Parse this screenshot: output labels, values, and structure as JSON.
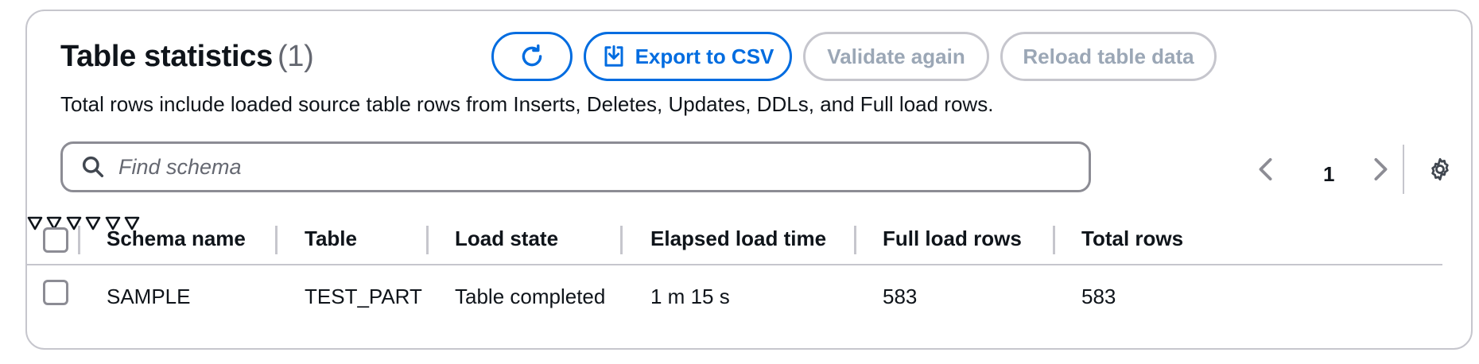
{
  "header": {
    "title": "Table statistics",
    "count": "(1)",
    "description": "Total rows include loaded source table rows from Inserts, Deletes, Updates, DDLs, and Full load rows."
  },
  "toolbar": {
    "refresh_icon": "refresh-icon",
    "export_label": "Export to CSV",
    "export_icon": "download-icon",
    "validate_label": "Validate again",
    "reload_label": "Reload table data"
  },
  "search": {
    "placeholder": "Find schema",
    "value": ""
  },
  "pagination": {
    "current_page": "1"
  },
  "table": {
    "columns": [
      "Schema name",
      "Table",
      "Load state",
      "Elapsed load time",
      "Full load rows",
      "Total rows"
    ],
    "rows": [
      [
        "SAMPLE",
        "TEST_PART",
        "Table completed",
        "1 m 15 s",
        "583",
        "583"
      ]
    ]
  },
  "colors": {
    "primary": "#006ce0",
    "disabled": "#9ba7b6",
    "border": "#c6c6cd"
  }
}
